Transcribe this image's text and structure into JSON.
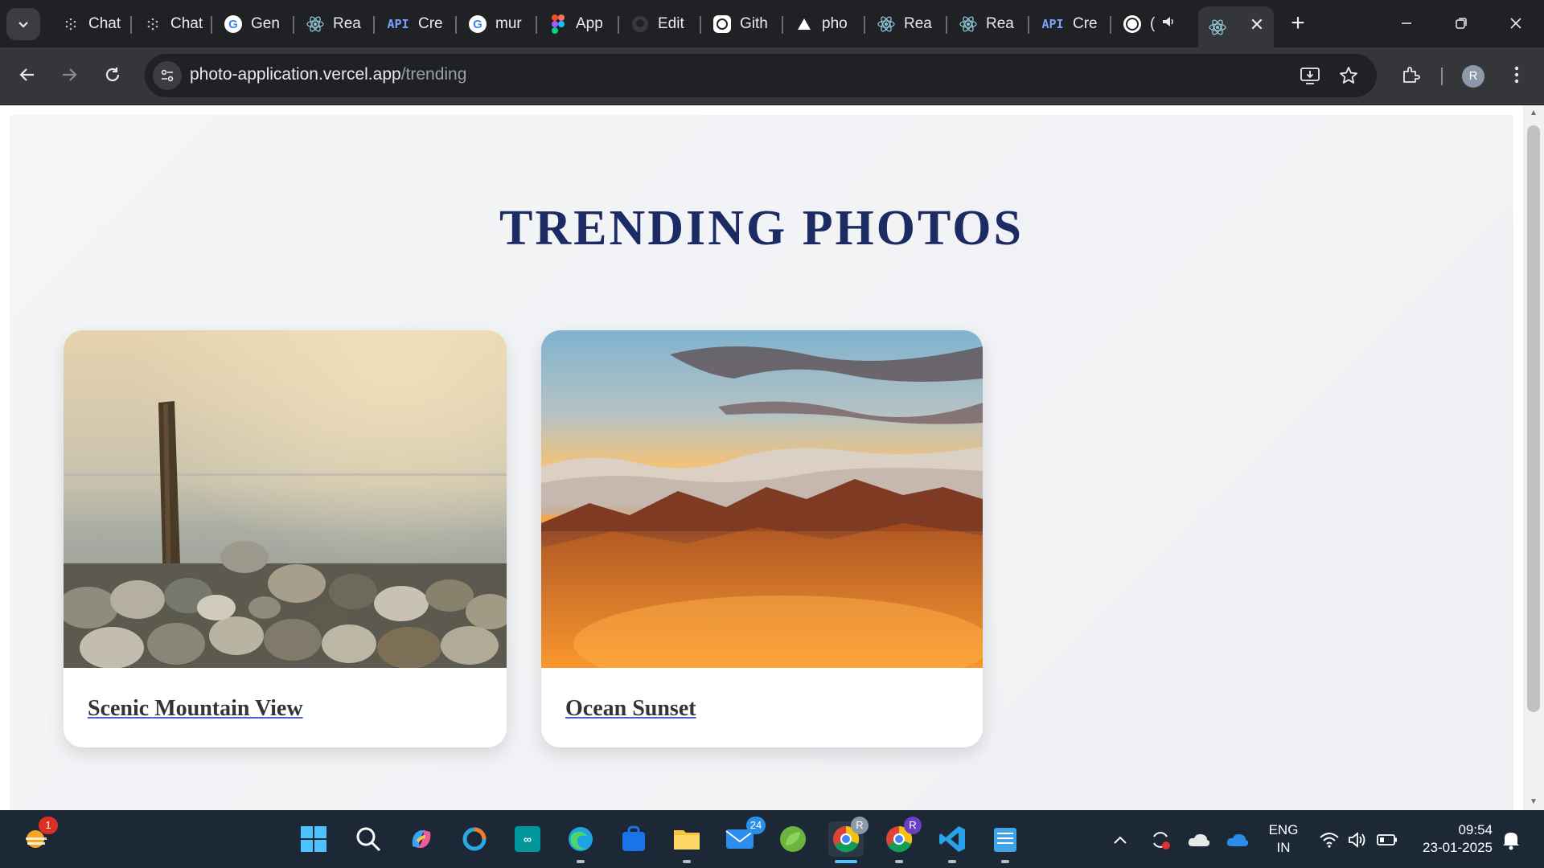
{
  "browser": {
    "tabs": [
      {
        "label": "Chat",
        "icon": "openai-icon"
      },
      {
        "label": "Chat",
        "icon": "openai-icon"
      },
      {
        "label": "Gen",
        "icon": "google-icon"
      },
      {
        "label": "Rea",
        "icon": "react-icon"
      },
      {
        "label": "Cre",
        "icon": "api-icon"
      },
      {
        "label": "mur",
        "icon": "google-icon"
      },
      {
        "label": "App",
        "icon": "figma-icon"
      },
      {
        "label": "Edit",
        "icon": "github-icon"
      },
      {
        "label": "Gith",
        "icon": "chatgpt-icon"
      },
      {
        "label": "pho",
        "icon": "vercel-icon"
      },
      {
        "label": "Rea",
        "icon": "react-icon"
      },
      {
        "label": "Rea",
        "icon": "react-icon"
      },
      {
        "label": "Cre",
        "icon": "api-icon"
      },
      {
        "label": "(",
        "icon": "whatsapp-icon"
      }
    ],
    "api_badge": "API",
    "active_tab_icon": "react-icon",
    "url_host": "photo-application.vercel.app",
    "url_path": "/trending",
    "profile_initial": "R"
  },
  "page": {
    "title": "TRENDING PHOTOS",
    "photos": [
      {
        "caption": "Scenic Mountain View"
      },
      {
        "caption": "Ocean Sunset"
      }
    ]
  },
  "taskbar": {
    "weather_badge": "1",
    "mail_badge": "24",
    "chrome_profile_badges": [
      "R",
      "R"
    ],
    "language_line1": "ENG",
    "language_line2": "IN",
    "time": "09:54",
    "date": "23-01-2025"
  },
  "colors": {
    "title": "#1c2b63",
    "accent_underline": "#4b5bd0",
    "taskbar_bg": "#1c2836",
    "chrome_dark": "#202124"
  }
}
